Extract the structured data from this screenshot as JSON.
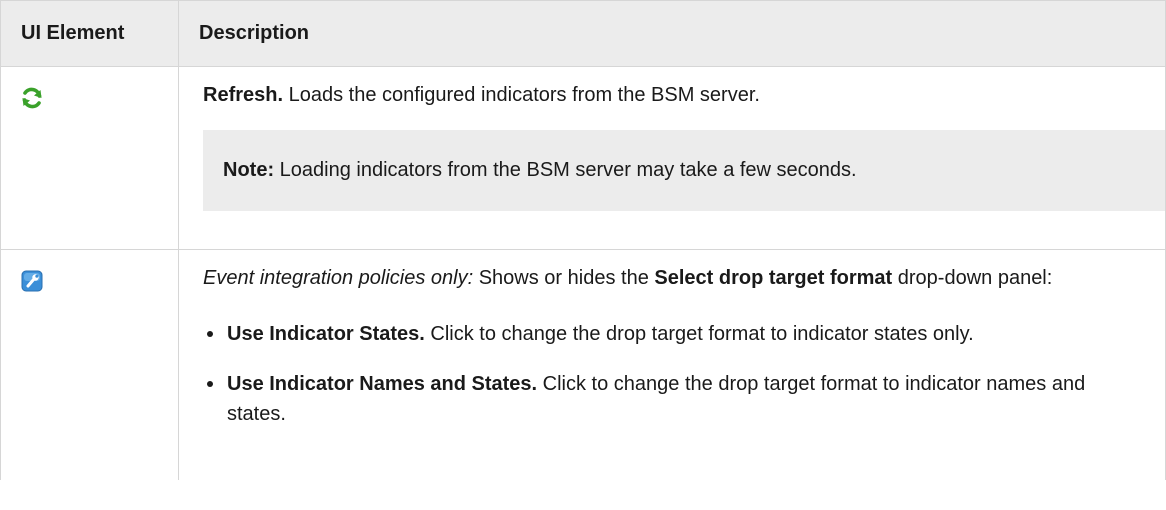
{
  "table": {
    "headers": [
      "UI Element",
      "Description"
    ],
    "rows": [
      {
        "icon": "refresh-icon",
        "lead": "Refresh.",
        "text": " Loads the configured indicators from the BSM server.",
        "note_label": "Note:",
        "note_text": " Loading indicators from the BSM server may take a few seconds."
      },
      {
        "icon": "wrench-icon",
        "prefix": "Event integration policies only:",
        "text_before": " Shows or hides the ",
        "bold_phrase": "Select drop target format",
        "text_after": " drop-down panel:",
        "bullets": [
          {
            "lead": "Use Indicator States.",
            "text": " Click to change the drop target format to indicator states only."
          },
          {
            "lead": "Use Indicator Names and States.",
            "text": " Click to change the drop target format to indicator names and states."
          }
        ]
      }
    ]
  },
  "colors": {
    "header_bg": "#ececec",
    "note_bg": "#ececec",
    "refresh_green": "#3aa12a",
    "wrench_blue": "#3b8fd8"
  }
}
